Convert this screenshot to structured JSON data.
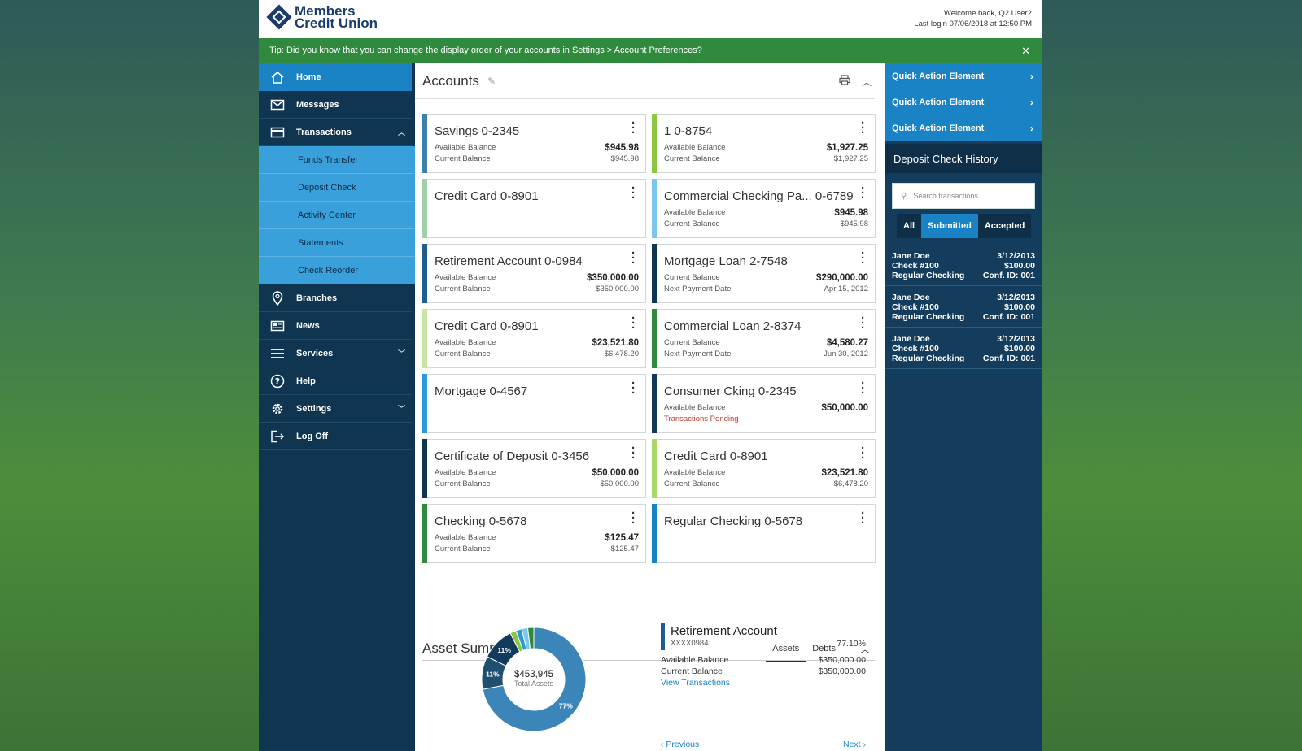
{
  "header": {
    "logo_line1": "Members",
    "logo_line2": "Credit Union",
    "welcome": "Welcome back, Q2 User2",
    "last_login": "Last login 07/06/2018 at 12:50 PM"
  },
  "tip": {
    "text": "Tip: Did you know that you can change the display order of your accounts in Settings > Account Preferences?",
    "close": "✕"
  },
  "nav": {
    "home": "Home",
    "messages": "Messages",
    "transactions": "Transactions",
    "sub": [
      "Funds Transfer",
      "Deposit Check",
      "Activity Center",
      "Statements",
      "Check Reorder"
    ],
    "branches": "Branches",
    "news": "News",
    "services": "Services",
    "help": "Help",
    "settings": "Settings",
    "logoff": "Log Off"
  },
  "accounts": {
    "title": "Accounts",
    "cards": [
      {
        "name": "Savings 0-2345",
        "color": "#3f7fae",
        "l1": "Available Balance",
        "v1": "$945.98",
        "l2": "Current Balance",
        "v2": "$945.98"
      },
      {
        "name": "1 0-8754",
        "color": "#8dc63f",
        "l1": "Available Balance",
        "v1": "$1,927.25",
        "l2": "Current Balance",
        "v2": "$1,927.25"
      },
      {
        "name": "Credit Card 0-8901",
        "color": "#9fd0a8",
        "l1": "",
        "v1": "",
        "l2": "",
        "v2": ""
      },
      {
        "name": "Commercial Checking Pa... 0-6789",
        "color": "#7cc7ef",
        "l1": "Available Balance",
        "v1": "$945.98",
        "l2": "Current Balance",
        "v2": "$945.98"
      },
      {
        "name": "Retirement Account 0-0984",
        "color": "#1f5d8f",
        "l1": "Available Balance",
        "v1": "$350,000.00",
        "l2": "Current Balance",
        "v2": "$350,000.00"
      },
      {
        "name": "Mortgage Loan 2-7548",
        "color": "#0f3550",
        "l1": "Current Balance",
        "v1": "$290,000.00",
        "l2": "Next Payment Date",
        "v2": "Apr 15, 2012"
      },
      {
        "name": "Credit Card 0-8901",
        "color": "#c8e6a0",
        "l1": "Available Balance",
        "v1": "$23,521.80",
        "l2": "Current Balance",
        "v2": "$6,478.20"
      },
      {
        "name": "Commercial Loan 2-8374",
        "color": "#2f8a3e",
        "l1": "Current Balance",
        "v1": "$4,580.27",
        "l2": "Next Payment Date",
        "v2": "Jun 30, 2012"
      },
      {
        "name": "Mortgage 0-4567",
        "color": "#2a9ad9",
        "l1": "",
        "v1": "",
        "l2": "",
        "v2": ""
      },
      {
        "name": "Consumer Cking 0-2345",
        "color": "#12385a",
        "l1": "Available Balance",
        "v1": "$50,000.00",
        "l2": "",
        "v2": "",
        "pending": "Transactions Pending"
      },
      {
        "name": "Certificate of Deposit 0-3456",
        "color": "#0f3550",
        "l1": "Available Balance",
        "v1": "$50,000.00",
        "l2": "Current Balance",
        "v2": "$50,000.00"
      },
      {
        "name": "Credit Card 0-8901",
        "color": "#a6d96a",
        "l1": "Available Balance",
        "v1": "$23,521.80",
        "l2": "Current Balance",
        "v2": "$6,478.20"
      },
      {
        "name": "Checking 0-5678",
        "color": "#2f8a3e",
        "l1": "Available Balance",
        "v1": "$125.47",
        "l2": "Current Balance",
        "v2": "$125.47"
      },
      {
        "name": "Regular Checking 0-5678",
        "color": "#1a83c6",
        "l1": "",
        "v1": "",
        "l2": "",
        "v2": ""
      }
    ]
  },
  "asset_summary": {
    "title": "Asset Summary",
    "tab_assets": "Assets",
    "tab_debts": "Debts",
    "total": "$453,945",
    "total_label": "Total Assets",
    "chart_data": {
      "type": "pie",
      "slices": [
        {
          "label": "77%",
          "value": 77,
          "color": "#3c85b8"
        },
        {
          "label": "11%",
          "value": 11,
          "color": "#1f5070"
        },
        {
          "label": "11%",
          "value": 11,
          "color": "#123a5c"
        },
        {
          "label": "",
          "value": 2,
          "color": "#8dc63f"
        },
        {
          "label": "",
          "value": 2,
          "color": "#2a9ad9"
        },
        {
          "label": "",
          "value": 2,
          "color": "#7cc7ef"
        },
        {
          "label": "",
          "value": 2,
          "color": "#2f8a3e"
        }
      ]
    },
    "detail": {
      "name": "Retirement Account",
      "number": "XXXX0984",
      "pct": "77.10%",
      "available_label": "Available Balance",
      "available": "$350,000.00",
      "current_label": "Current Balance",
      "current": "$350,000.00",
      "link": "View Transactions",
      "prev": "Previous",
      "next": "Next"
    }
  },
  "right": {
    "quick_actions": [
      "Quick Action Element",
      "Quick Action Element",
      "Quick Action Element"
    ],
    "history_title": "Deposit Check History",
    "search_placeholder": "Search transactions",
    "filters": [
      "All",
      "Submitted",
      "Accepted"
    ],
    "transactions": [
      {
        "name": "Jane Doe",
        "check": "Check #100",
        "account": "Regular Checking",
        "date": "3/12/2013",
        "amount": "$100.00",
        "conf": "Conf. ID: 001"
      },
      {
        "name": "Jane Doe",
        "check": "Check #100",
        "account": "Regular Checking",
        "date": "3/12/2013",
        "amount": "$100.00",
        "conf": "Conf. ID: 001"
      },
      {
        "name": "Jane Doe",
        "check": "Check #100",
        "account": "Regular Checking",
        "date": "3/12/2013",
        "amount": "$100.00",
        "conf": "Conf. ID: 001"
      }
    ]
  }
}
